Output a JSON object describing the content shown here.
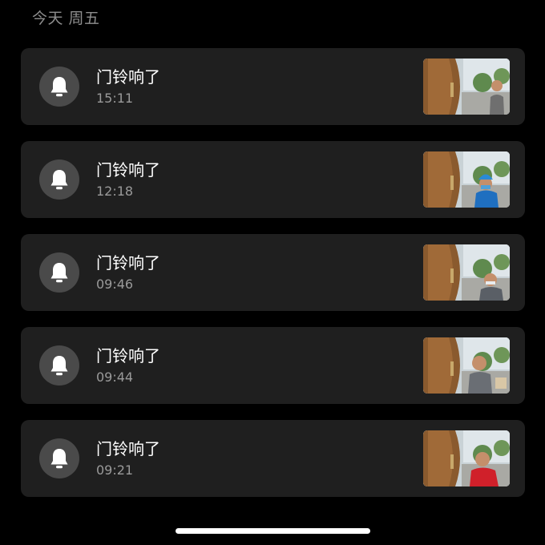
{
  "date_header": "今天 周五",
  "events": [
    {
      "title": "门铃响了",
      "time": "15:11",
      "icon": "bell-icon",
      "visitor_shirt": "#6f6f6f",
      "visitor_helmet": ""
    },
    {
      "title": "门铃响了",
      "time": "12:18",
      "icon": "bell-icon",
      "visitor_shirt": "#1f6fc0",
      "visitor_helmet": "#2a8ad6"
    },
    {
      "title": "门铃响了",
      "time": "09:46",
      "icon": "bell-icon",
      "visitor_shirt": "#5a5f66",
      "visitor_helmet": ""
    },
    {
      "title": "门铃响了",
      "time": "09:44",
      "icon": "bell-icon",
      "visitor_shirt": "#6a6e74",
      "visitor_helmet": ""
    },
    {
      "title": "门铃响了",
      "time": "09:21",
      "icon": "bell-icon",
      "visitor_shirt": "#d0202a",
      "visitor_helmet": ""
    }
  ],
  "colors": {
    "background": "#000000",
    "card": "#1f1f1f",
    "icon_circle": "#4a4a4a",
    "secondary_text": "#9a9a9a"
  }
}
